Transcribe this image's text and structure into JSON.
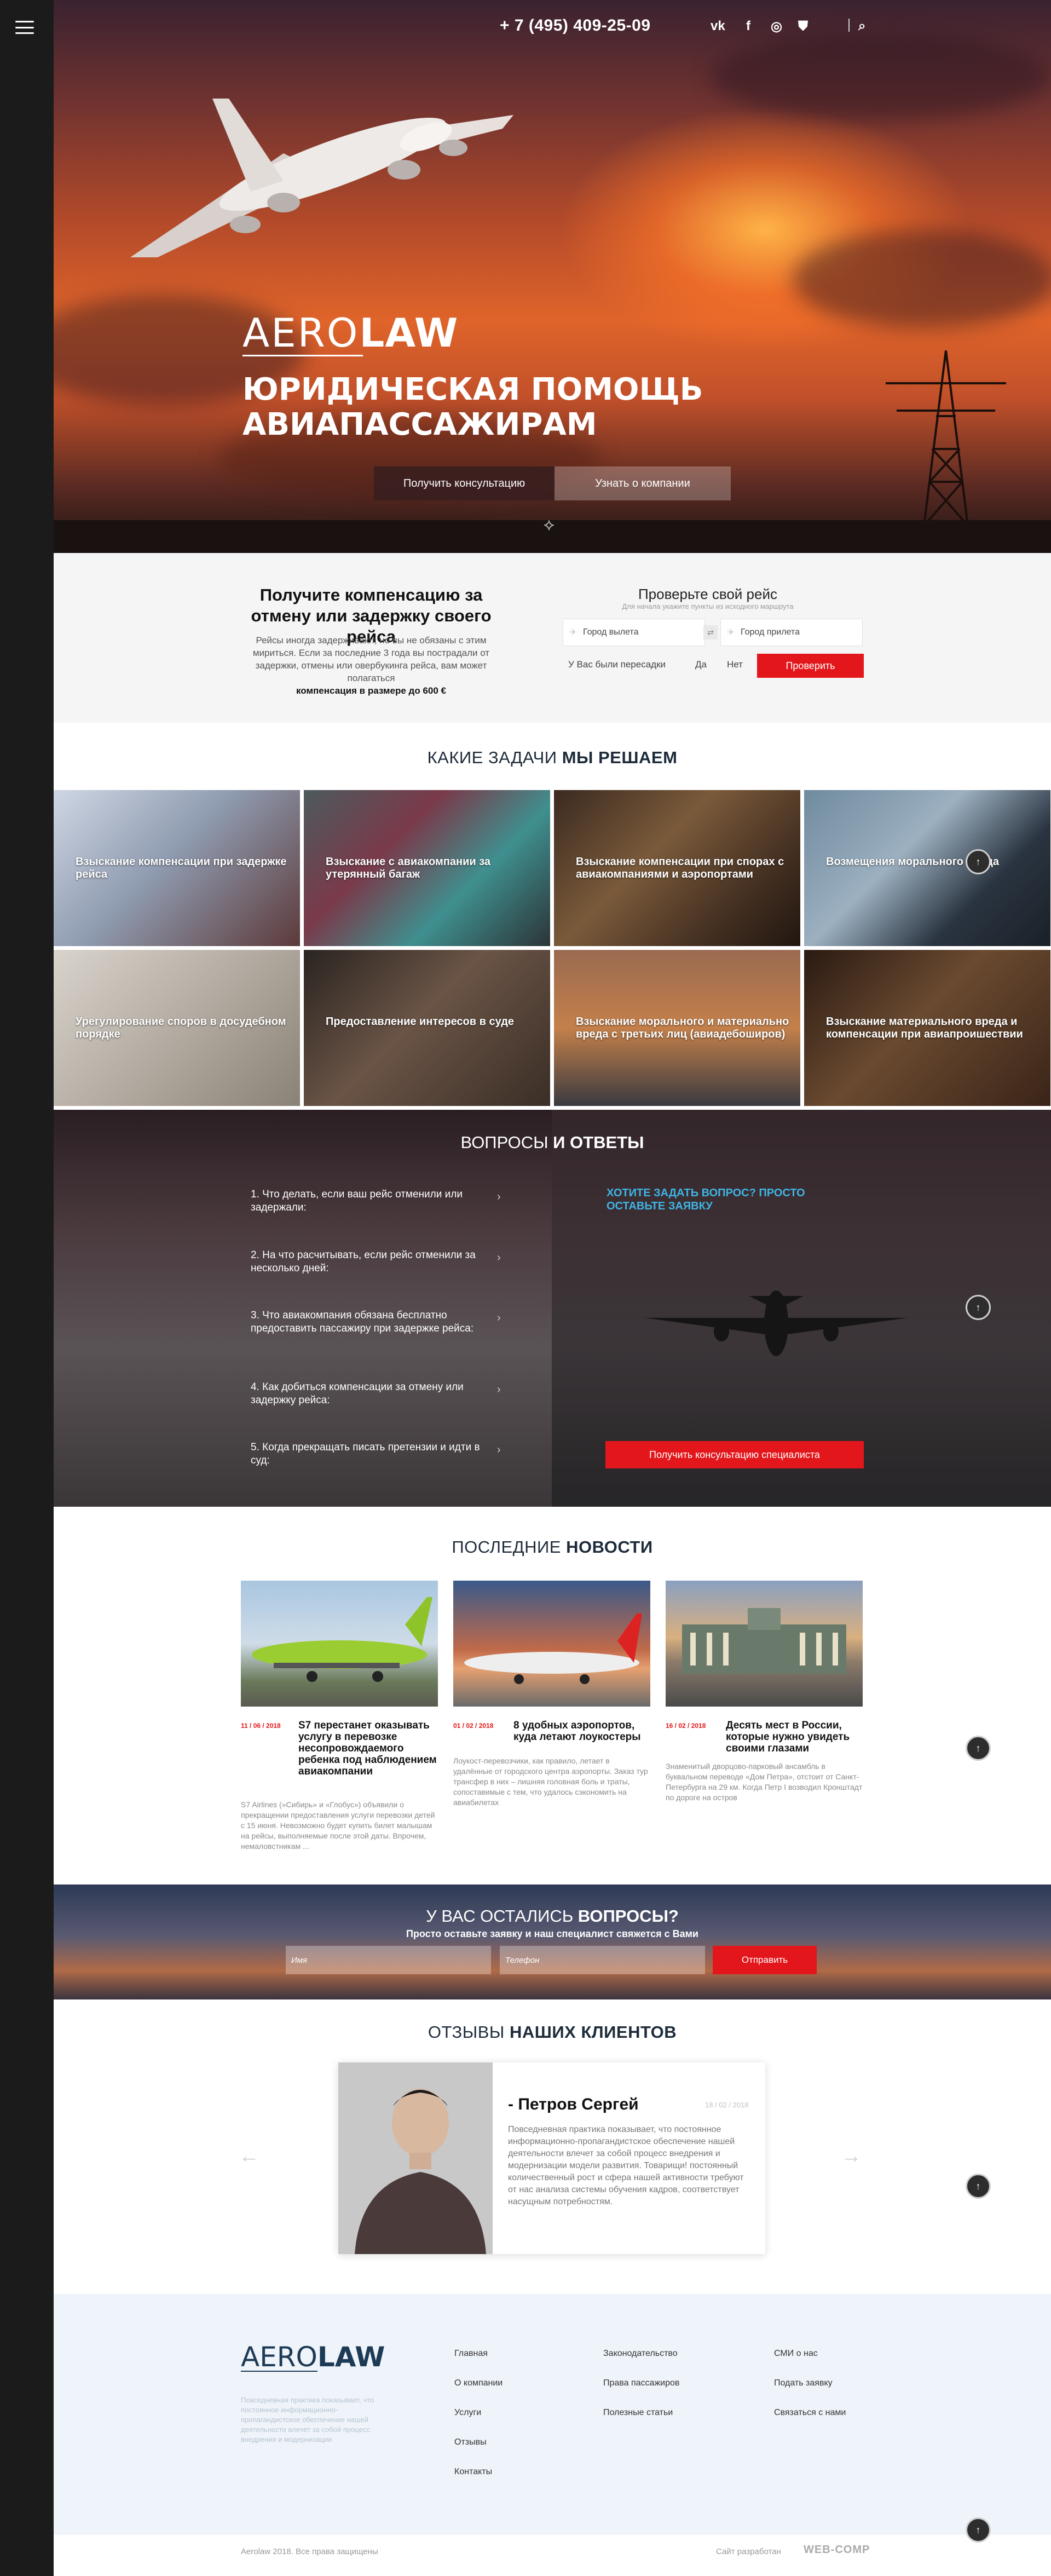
{
  "header": {
    "phone": "+ 7 (495) 409-25-09",
    "social": [
      "vk-icon",
      "facebook-icon",
      "instagram-icon",
      "shield-icon"
    ]
  },
  "hero": {
    "logo_thin": "AERO",
    "logo_bold": "LAW",
    "title_line1": "ЮРИДИЧЕСКАЯ ПОМОЩЬ",
    "title_line2": "АВИАПАССАЖИРАМ",
    "btn_consult": "Получить консультацию",
    "btn_about": "Узнать о компании"
  },
  "check": {
    "title": "Получите компенсацию за отмену или задержку своего рейса",
    "text": "Рейсы иногда задерживают, но вы не обязаны с этим мириться. Если за последние 3 года вы пострадали от задержки, отмены или овербукинга рейса, вам может полагаться",
    "text_bold": "компенсация в размере до 600 €",
    "form_title": "Проверьте свой рейс",
    "form_hint": "Для начала укажите пункты из исходного маршрута",
    "from_placeholder": "Город вылета",
    "to_placeholder": "Город прилета",
    "transfers_label": "У Вас были пересадки",
    "yes": "Да",
    "no": "Нет",
    "submit": "Проверить"
  },
  "tasks": {
    "title_light": "КАКИЕ ЗАДАЧИ",
    "title_bold": "МЫ РЕШАЕМ",
    "items": [
      {
        "label": "Взыскание компенсации при задержке рейса"
      },
      {
        "label": "Взыскание с авиакомпании за утерянный багаж"
      },
      {
        "label": "Взыскание компенсации при спорах с авиакомпаниями и аэропортами"
      },
      {
        "label": "Возмещения морального вреда"
      },
      {
        "label": "Урегулирование споров в досудебном порядке"
      },
      {
        "label": "Предоставление интересов в суде"
      },
      {
        "label": "Взыскание морального и материально вреда с третьих лиц (авиадебоширов)"
      },
      {
        "label": "Взыскание материального вреда и компенсации при авиапроишествии"
      }
    ]
  },
  "faq": {
    "title_light": "ВОПРОСЫ",
    "title_bold": "И ОТВЕТЫ",
    "questions": [
      "1. Что делать, если ваш рейс отменили или задержали:",
      "2. На что расчитывать, если рейс отменили за несколько дней:",
      "3. Что авиакомпания обязана бесплатно предоставить пассажиру при задержке рейса:",
      "4. Как добиться компенсации за отмену или задержку рейса:",
      "5. Когда прекращать писать претензии и идти в суд:"
    ],
    "ask": "ХОТИТЕ ЗАДАТЬ ВОПРОС? ПРОСТО ОСТАВЬТЕ ЗАЯВКУ",
    "btn": "Получить консультацию специалиста"
  },
  "news": {
    "title_light": "ПОСЛЕДНИЕ",
    "title_bold": "НОВОСТИ",
    "items": [
      {
        "date": "11 / 06 / 2018",
        "title": "S7 перестанет оказывать услугу в перевозке несопровождаемого ребенка под наблюдением авиакомпании",
        "text": "S7 Airlines (»Сибирь» и «Глобус») объявили о прекращении предоставления услуги перевозки детей с 15 июня. Невозможно будет купить билет малышам на рейсы, выполняемые после этой даты. Впрочем, немаловстникам ..."
      },
      {
        "date": "01 / 02 / 2018",
        "title": "8 удобных аэропортов, куда летают лоукостеры",
        "text": "Лоукост-перевозчики, как правило, летает в удалённые от городского центра аэропорты. Заказ тур трансфер в них – лишняя головная боль и траты, сопоставимые с тем, что удалось сэкономить на авиабилетах"
      },
      {
        "date": "16 / 02 / 2018",
        "title": "Десять мест в России, которые нужно увидеть своими глазами",
        "text": "Знаменитый дворцово-парковый ансамбль в буквальном переводе «Дом Петра», отстоит от Санкт-Петербурга на 29 км. Когда Петр I возводил Кронштадт по дороге на остров"
      }
    ]
  },
  "question_band": {
    "title_light": "У ВАС ОСТАЛИСЬ",
    "title_bold": "ВОПРОСЫ?",
    "subtitle": "Просто оставьте заявку и наш специалист свяжется с Вами",
    "name_placeholder": "Имя",
    "phone_placeholder": "Телефон",
    "btn": "Отправить"
  },
  "reviews": {
    "title_light": "ОТЗЫВЫ",
    "title_bold": "НАШИХ КЛИЕНТОВ",
    "name": "- Петров Сергей",
    "date": "18 / 02 / 2018",
    "text": "Повседневная практика показывает, что постоянное информационно-пропагандистское обеспечение нашей деятельности влечет за собой процесс внедрения и модернизации модели развития. Товарищи! постоянный количественный рост и сфера нашей активности требуют от нас анализа системы обучения кадров, соответствует насущным потребностям."
  },
  "footer": {
    "logo_thin": "AERO",
    "logo_bold": "LAW",
    "desc": "Повседневная практика показывает, что постоянное информационно-пропагандистское обеспечение нашей деятельности влечет за собой процесс внедрения и модернизации",
    "col1": [
      "Главная",
      "О компании",
      "Услуги",
      "Отзывы",
      "Контакты"
    ],
    "col2": [
      "Законодательство",
      "Права пассажиров",
      "Полезные статьи"
    ],
    "col3": [
      "СМИ о нас",
      "Подать заявку",
      "Связаться с нами"
    ],
    "copyright": "Aerolaw 2018. Все права защищены",
    "developer_label": "Сайт разработан",
    "developer_logo": "WEB-COMP"
  }
}
